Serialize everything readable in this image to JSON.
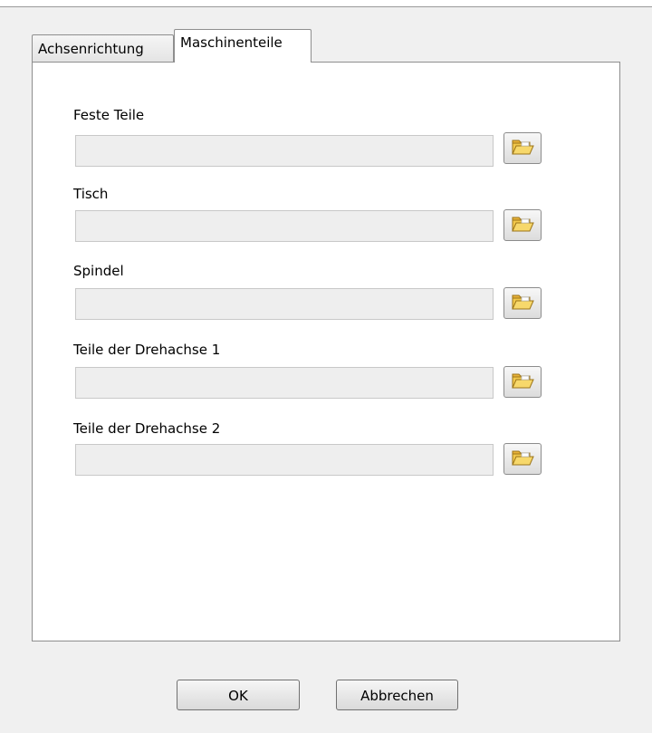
{
  "tabs": [
    {
      "label": "Achsenrichtung",
      "active": false
    },
    {
      "label": "Maschinenteile",
      "active": true
    }
  ],
  "fields": [
    {
      "label": "Feste Teile",
      "value": "",
      "icon": "folder-open-icon"
    },
    {
      "label": "Tisch",
      "value": "",
      "icon": "folder-open-icon"
    },
    {
      "label": "Spindel",
      "value": "",
      "icon": "folder-open-icon"
    },
    {
      "label": "Teile der Drehachse 1",
      "value": "",
      "icon": "folder-open-icon"
    },
    {
      "label": "Teile der Drehachse 2",
      "value": "",
      "icon": "folder-open-icon"
    }
  ],
  "buttons": {
    "ok_label": "OK",
    "cancel_label": "Abbrechen"
  },
  "colors": {
    "window_bg": "#f0f0f0",
    "panel_bg": "#ffffff",
    "field_bg": "#eeeeee",
    "folder_yellow": "#f2c84b"
  }
}
